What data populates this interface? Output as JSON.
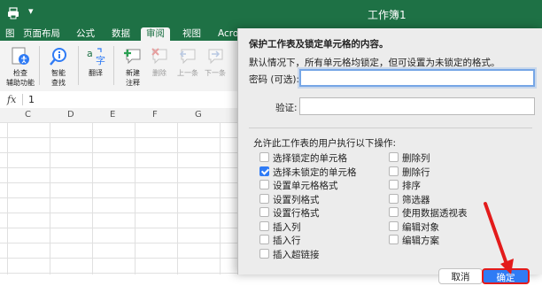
{
  "window": {
    "title": "工作簿1",
    "more_glyph": "▾"
  },
  "tabs": [
    "页面布局",
    "公式",
    "数据",
    "审阅",
    "视图",
    "Acro"
  ],
  "ribbon": {
    "buttons": [
      {
        "label1": "检查",
        "label2": "辅助功能"
      },
      {
        "label1": "智能",
        "label2": "查找"
      },
      {
        "label1": "翻译",
        "label2": ""
      },
      {
        "label1": "新建",
        "label2": "注释"
      },
      {
        "label1": "删除",
        "label2": ""
      },
      {
        "label1": "上一条",
        "label2": ""
      },
      {
        "label1": "下一条",
        "label2": ""
      }
    ]
  },
  "formula_bar": {
    "fx": "fx",
    "value": "1"
  },
  "columns": [
    "C",
    "D",
    "E",
    "F",
    "G"
  ],
  "dialog": {
    "heading": "保护工作表及锁定单元格的内容。",
    "description": "默认情况下，所有单元格均锁定，但可设置为未锁定的格式。",
    "password_label": "密码 (可选):",
    "password_value": "",
    "verify_label": "验证:",
    "verify_value": "",
    "allow_label": "允许此工作表的用户执行以下操作:",
    "permissions_left": [
      {
        "label": "选择锁定的单元格",
        "checked": false
      },
      {
        "label": "选择未锁定的单元格",
        "checked": true
      },
      {
        "label": "设置单元格格式",
        "checked": false
      },
      {
        "label": "设置列格式",
        "checked": false
      },
      {
        "label": "设置行格式",
        "checked": false
      },
      {
        "label": "插入列",
        "checked": false
      },
      {
        "label": "插入行",
        "checked": false
      },
      {
        "label": "插入超链接",
        "checked": false
      }
    ],
    "permissions_right": [
      {
        "label": "删除列",
        "checked": false
      },
      {
        "label": "删除行",
        "checked": false
      },
      {
        "label": "排序",
        "checked": false
      },
      {
        "label": "筛选器",
        "checked": false
      },
      {
        "label": "使用数据透视表",
        "checked": false
      },
      {
        "label": "编辑对象",
        "checked": false
      },
      {
        "label": "编辑方案",
        "checked": false
      }
    ],
    "cancel_label": "取消",
    "ok_label": "确定"
  },
  "colors": {
    "excel_green": "#1e7145",
    "accent_blue": "#2f7bf5",
    "annotation_red": "#e31b1b"
  }
}
